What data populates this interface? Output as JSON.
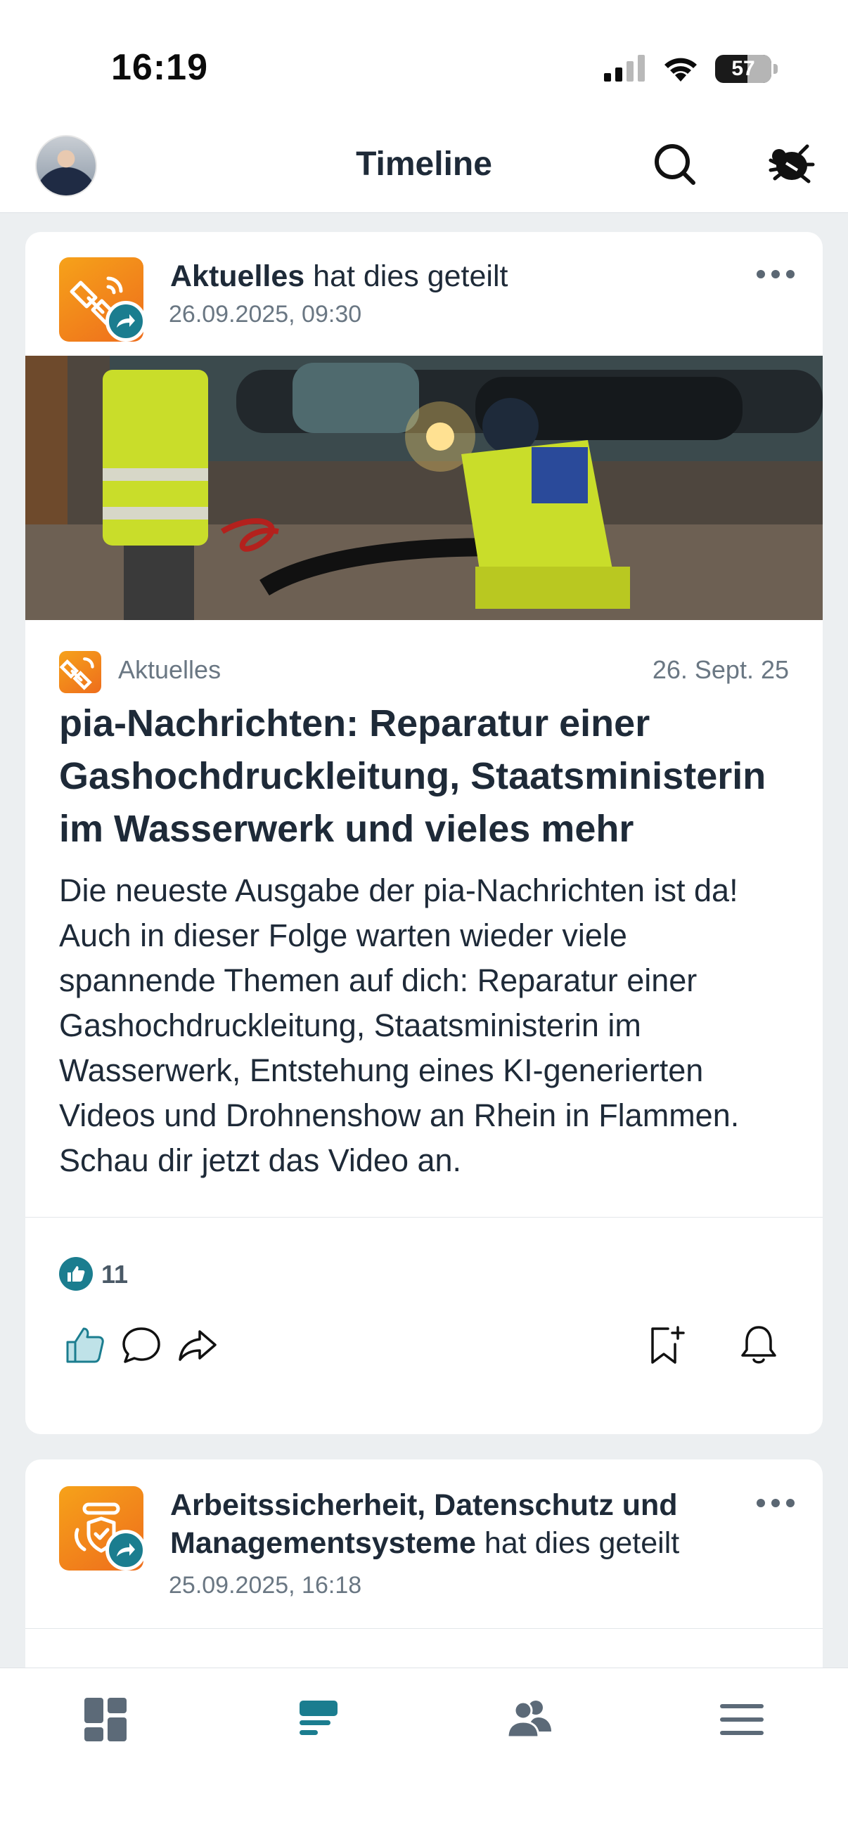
{
  "status_bar": {
    "time": "16:19",
    "battery": "57",
    "icons": [
      "cellular-signal-icon",
      "wifi-icon",
      "battery-icon"
    ]
  },
  "header": {
    "title": "Timeline",
    "icons": [
      "avatar",
      "search-icon",
      "bug-icon"
    ]
  },
  "posts": [
    {
      "shared_by": "Aktuelles",
      "shared_suffix": "hat dies geteilt",
      "shared_date": "26.09.2025, 09:30",
      "source_name": "Aktuelles",
      "source_date": "26. Sept. 25",
      "title": "pia-Nachrichten: Reparatur einer Gashochdruckleitung, Staatsministerin im Wasserwerk und vieles mehr",
      "body": "Die neueste Ausgabe der pia-Nachrichten ist da! Auch in dieser Folge warten wieder viele spannende Themen auf dich: Reparatur einer Gashochdruckleitung, Staatsministerin im Wasserwerk, Entstehung eines KI-generierten Videos und Drohnenshow an Rhein in Flammen. Schau dir jetzt das Video an.",
      "likes": "11"
    },
    {
      "shared_by_line1": "Arbeitssicherheit, Datenschutz und",
      "shared_by_line2": "Managementsysteme",
      "shared_suffix": "hat dies geteilt",
      "shared_date": "25.09.2025, 16:18"
    }
  ],
  "bottom_nav": {
    "items": [
      "dashboard-icon",
      "timeline-icon",
      "people-icon",
      "menu-icon"
    ],
    "active": "timeline-icon"
  },
  "colors": {
    "accent": "#1b7d8f",
    "channel_orange": "#f08a1c",
    "text": "#1e2a38",
    "muted": "#6a7783",
    "background": "#eceff1"
  }
}
